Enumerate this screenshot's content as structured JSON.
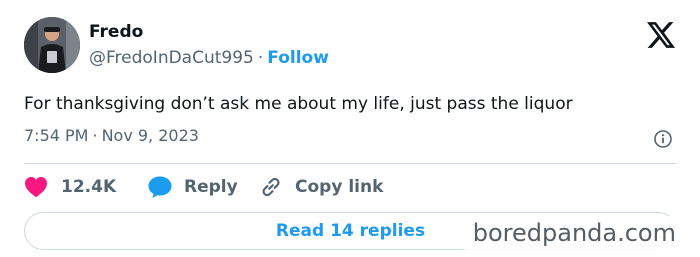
{
  "author": {
    "name": "Fredo",
    "handle": "@FredoInDaCut995",
    "separator": "·",
    "follow_label": "Follow"
  },
  "logo": {
    "icon": "x-logo-icon"
  },
  "tweet": {
    "text": "For thanksgiving don’t ask me about my life, just pass the liquor",
    "time": "7:54 PM",
    "separator": "·",
    "date": "Nov 9, 2023"
  },
  "actions": {
    "likes_count": "12.4K",
    "reply_label": "Reply",
    "copy_label": "Copy link"
  },
  "replies_button": {
    "label": "Read 14 replies"
  },
  "watermark": {
    "text": "boredpanda.com"
  },
  "colors": {
    "accent": "#1d9bf0",
    "heart": "#f91880",
    "text_primary": "#0f1419",
    "text_secondary": "#536471",
    "border": "#cfd9de"
  }
}
